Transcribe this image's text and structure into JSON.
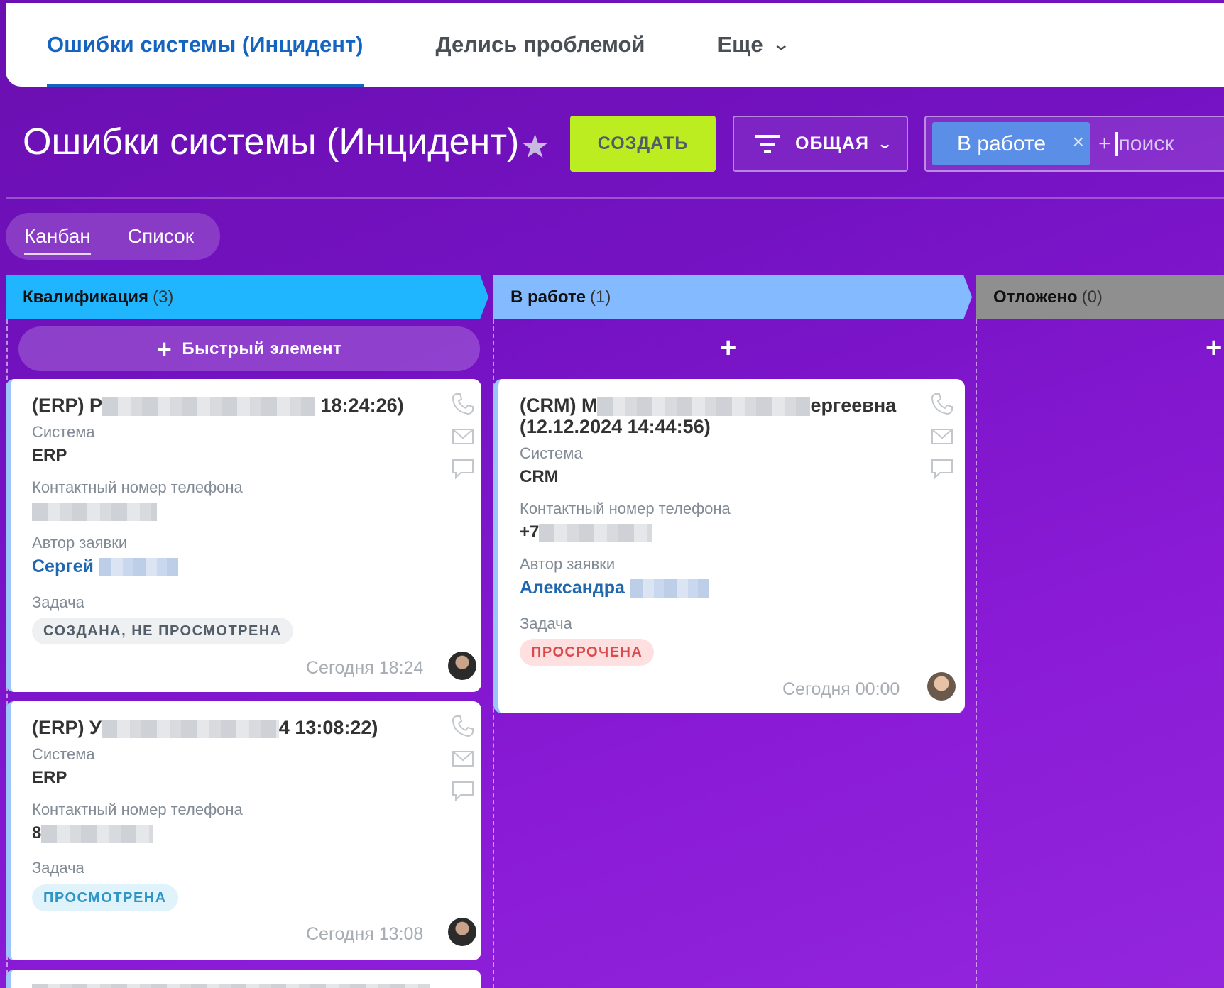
{
  "tabs": [
    {
      "label": "Ошибки системы (Инцидент)",
      "active": true
    },
    {
      "label": "Делись проблемой",
      "active": false
    },
    {
      "label": "Еще",
      "active": false
    }
  ],
  "header": {
    "title": "Ошибки системы (Инцидент)",
    "create_label": "СОЗДАТЬ",
    "filter_label": "ОБЩАЯ",
    "search_tag": "В работе",
    "search_placeholder": "поиск"
  },
  "view_switch": {
    "kanban": "Канбан",
    "list": "Список"
  },
  "columns": [
    {
      "name": "Квалификация",
      "count": "(3)",
      "color": "#20b6ff"
    },
    {
      "name": "В работе",
      "count": "(1)",
      "color": "#84baff"
    },
    {
      "name": "Отложено",
      "count": "(0)",
      "color": "#8f8f8f"
    }
  ],
  "quick_item_label": "Быстрый элемент",
  "cards": [
    {
      "title_start": "(ERP) Р",
      "title_end": "18:24:26)",
      "system_label": "Система",
      "system_value": "ERP",
      "phone_label": "Контактный номер телефона",
      "author_label": "Автор заявки",
      "author_name": "Сергей",
      "task_label": "Задача",
      "task_status": "СОЗДАНА, НЕ ПРОСМОТРЕНА",
      "date": "Сегодня 18:24"
    },
    {
      "title_start": "(ERP) У",
      "title_end": "4 13:08:22)",
      "system_label": "Система",
      "system_value": "ERP",
      "phone_label": "Контактный номер телефона",
      "phone_prefix": "8",
      "task_label": "Задача",
      "task_status": "ПРОСМОТРЕНА",
      "date": "Сегодня 13:08"
    },
    {
      "title_start": "(CRM) М",
      "title_end": "ергеевна",
      "title_line2": "(12.12.2024 14:44:56)",
      "system_label": "Система",
      "system_value": "CRM",
      "phone_label": "Контактный номер телефона",
      "phone_prefix": "+7",
      "author_label": "Автор заявки",
      "author_name": "Александра",
      "task_label": "Задача",
      "task_status": "ПРОСРОЧЕНА",
      "date": "Сегодня 00:00"
    }
  ],
  "icons": [
    "phone-icon",
    "mail-icon",
    "chat-icon",
    "star-icon",
    "filter-icon",
    "chevron-down-icon",
    "close-icon",
    "plus-icon"
  ]
}
